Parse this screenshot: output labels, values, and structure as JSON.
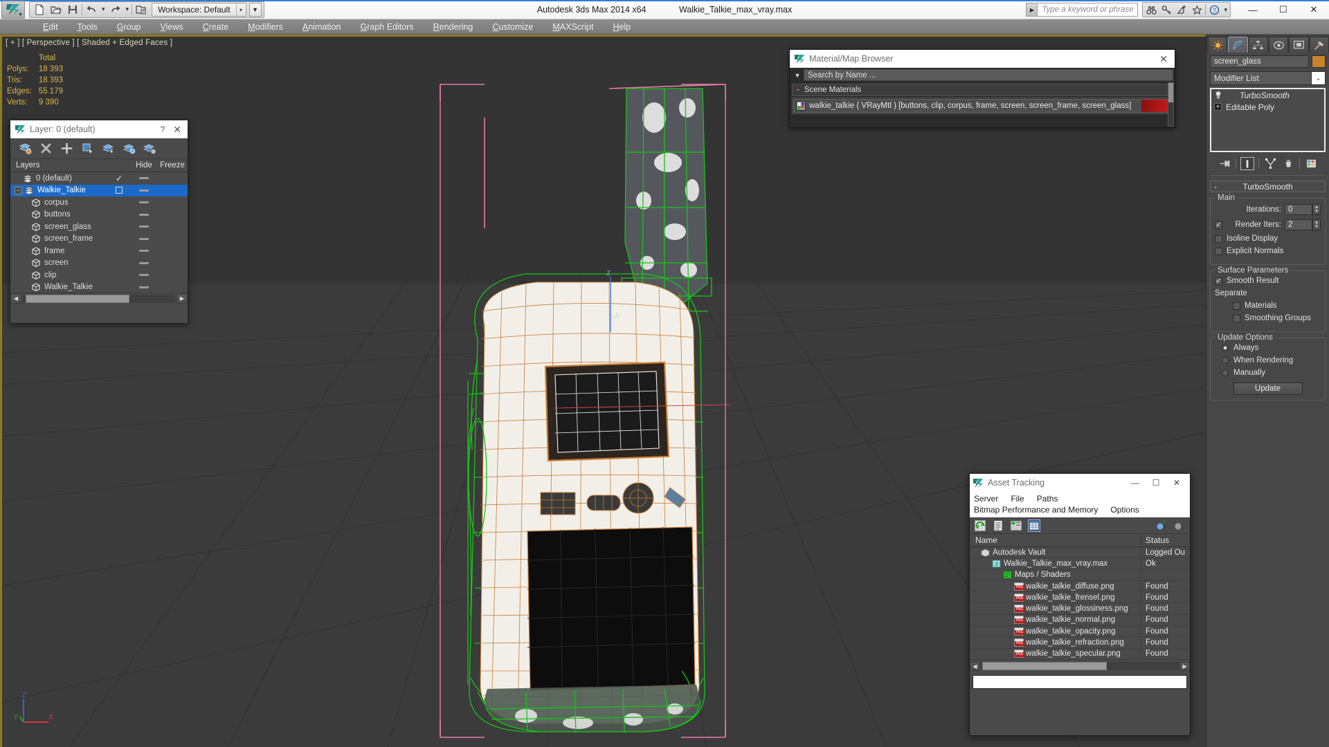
{
  "titlebar": {
    "workspace": "Workspace: Default",
    "app_title": "Autodesk 3ds Max  2014 x64",
    "file_title": "Walkie_Talkie_max_vray.max",
    "search_placeholder": "Type a keyword or phrase",
    "minimize": "—",
    "maximize": "☐",
    "close": "✕"
  },
  "menubar": {
    "items": [
      {
        "label": "Edit"
      },
      {
        "label": "Tools"
      },
      {
        "label": "Group"
      },
      {
        "label": "Views"
      },
      {
        "label": "Create"
      },
      {
        "label": "Modifiers"
      },
      {
        "label": "Animation"
      },
      {
        "label": "Graph Editors"
      },
      {
        "label": "Rendering"
      },
      {
        "label": "Customize"
      },
      {
        "label": "MAXScript"
      },
      {
        "label": "Help"
      }
    ]
  },
  "viewport": {
    "label": "[ + ] [ Perspective ] [ Shaded + Edged Faces ]",
    "stats": {
      "header": "Total",
      "rows": [
        {
          "label": "Polys:",
          "value": "18 393"
        },
        {
          "label": "Tris:",
          "value": "18 393"
        },
        {
          "label": "Edges:",
          "value": "55 179"
        },
        {
          "label": "Verts:",
          "value": "9 390"
        }
      ]
    },
    "axis": {
      "x": "X",
      "y": "Y",
      "z": "Z"
    }
  },
  "layer_dialog": {
    "title": "Layer: 0 (default)",
    "help": "?",
    "close": "✕",
    "columns": {
      "name": "Layers",
      "hide": "Hide",
      "freeze": "Freeze"
    },
    "rows": [
      {
        "name": "0 (default)",
        "indent": 1,
        "selected": false,
        "expander": false,
        "mark": "check",
        "type": "layer"
      },
      {
        "name": "Walkie_Talkie",
        "indent": 0,
        "selected": true,
        "expander": true,
        "mark": "square",
        "type": "layer"
      },
      {
        "name": "corpus",
        "indent": 2,
        "selected": false,
        "expander": false,
        "mark": "",
        "type": "object"
      },
      {
        "name": "buttons",
        "indent": 2,
        "selected": false,
        "expander": false,
        "mark": "",
        "type": "object"
      },
      {
        "name": "screen_glass",
        "indent": 2,
        "selected": false,
        "expander": false,
        "mark": "",
        "type": "object"
      },
      {
        "name": "screen_frame",
        "indent": 2,
        "selected": false,
        "expander": false,
        "mark": "",
        "type": "object"
      },
      {
        "name": "frame",
        "indent": 2,
        "selected": false,
        "expander": false,
        "mark": "",
        "type": "object"
      },
      {
        "name": "screen",
        "indent": 2,
        "selected": false,
        "expander": false,
        "mark": "",
        "type": "object"
      },
      {
        "name": "clip",
        "indent": 2,
        "selected": false,
        "expander": false,
        "mark": "",
        "type": "object"
      },
      {
        "name": "Walkie_Talkie",
        "indent": 2,
        "selected": false,
        "expander": false,
        "mark": "",
        "type": "object"
      }
    ]
  },
  "material_browser": {
    "title": "Material/Map Browser",
    "close": "✕",
    "search_value": "Search by Name ...",
    "section": "Scene Materials",
    "section_toggle": "-",
    "material": "walkie_talkie  ( VRayMtl ) [buttons, clip, corpus, frame, screen, screen_frame, screen_glass]"
  },
  "asset_tracking": {
    "title": "Asset Tracking",
    "minimize": "—",
    "maximize": "☐",
    "close": "✕",
    "menus_row1": [
      "Server",
      "File",
      "Paths"
    ],
    "menus_row2": [
      "Bitmap Performance and Memory",
      "Options"
    ],
    "columns": {
      "name": "Name",
      "status": "Status"
    },
    "rows": [
      {
        "name": "Autodesk Vault",
        "status": "Logged Ou",
        "indent": 1,
        "icon": "vault"
      },
      {
        "name": "Walkie_Talkie_max_vray.max",
        "status": "Ok",
        "indent": 2,
        "icon": "max"
      },
      {
        "name": "Maps / Shaders",
        "status": "",
        "indent": 3,
        "icon": "maps"
      },
      {
        "name": "walkie_talkie_diffuse.png",
        "status": "Found",
        "indent": 4,
        "icon": "png"
      },
      {
        "name": "walkie_talkie_frensel.png",
        "status": "Found",
        "indent": 4,
        "icon": "png"
      },
      {
        "name": "walkie_talkie_glossiness.png",
        "status": "Found",
        "indent": 4,
        "icon": "png"
      },
      {
        "name": "walkie_talkie_normal.png",
        "status": "Found",
        "indent": 4,
        "icon": "png"
      },
      {
        "name": "walkie_talkie_opacity.png",
        "status": "Found",
        "indent": 4,
        "icon": "png"
      },
      {
        "name": "walkie_talkie_refraction.png",
        "status": "Found",
        "indent": 4,
        "icon": "png"
      },
      {
        "name": "walkie_talkie_specular.png",
        "status": "Found",
        "indent": 4,
        "icon": "png"
      }
    ]
  },
  "command_panel": {
    "object_name": "screen_glass",
    "object_color": "#c8832a",
    "modifier_list": "Modifier List",
    "stack": [
      {
        "label": "TurboSmooth",
        "type": "modifier"
      },
      {
        "label": "Editable Poly",
        "type": "base"
      }
    ],
    "rollout": {
      "toggle": "-",
      "title": "TurboSmooth",
      "groups": [
        {
          "title": "Main",
          "fields": [
            {
              "kind": "spinner",
              "label": "Iterations:",
              "value": "0",
              "checkbox": null
            },
            {
              "kind": "spinner",
              "label": "Render Iters:",
              "value": "2",
              "checkbox": true,
              "checkbox_label": "Render Iters:"
            },
            {
              "kind": "check",
              "label": "Isoline Display",
              "checked": false
            },
            {
              "kind": "check",
              "label": "Explicit Normals",
              "checked": false
            }
          ]
        },
        {
          "title": "Surface Parameters",
          "fields": [
            {
              "kind": "check",
              "label": "Smooth Result",
              "checked": true
            },
            {
              "kind": "text",
              "label": "Separate"
            },
            {
              "kind": "check-indent",
              "label": "Materials",
              "checked": false
            },
            {
              "kind": "check-indent",
              "label": "Smoothing Groups",
              "checked": false
            }
          ]
        },
        {
          "title": "Update Options",
          "fields": [
            {
              "kind": "radio",
              "label": "Always",
              "checked": true
            },
            {
              "kind": "radio",
              "label": "When Rendering",
              "checked": false
            },
            {
              "kind": "radio",
              "label": "Manually",
              "checked": false
            },
            {
              "kind": "button",
              "label": "Update"
            }
          ]
        }
      ]
    }
  }
}
